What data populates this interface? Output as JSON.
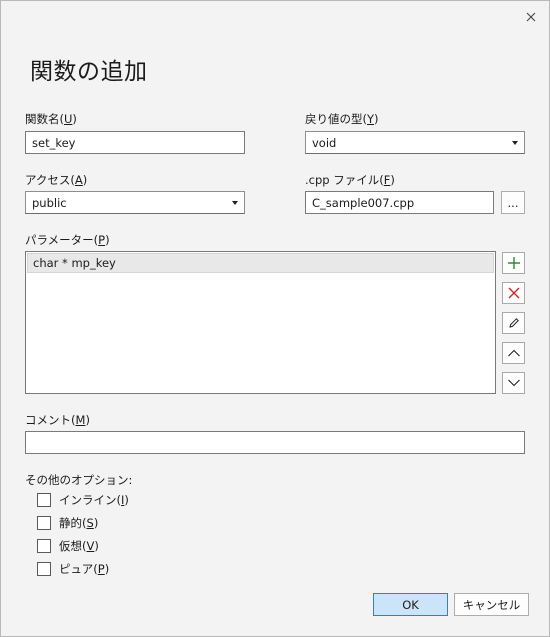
{
  "dialog": {
    "title": "関数の追加"
  },
  "function_name": {
    "label": "関数名(",
    "mnemonic": "U",
    "label_end": ")",
    "value": "set_key"
  },
  "return_type": {
    "label": "戻り値の型(",
    "mnemonic": "Y",
    "label_end": ")",
    "value": "void"
  },
  "access": {
    "label": "アクセス(",
    "mnemonic": "A",
    "label_end": ")",
    "value": "public"
  },
  "cpp_file": {
    "label": ".cpp ファイル(",
    "mnemonic": "F",
    "label_end": ")",
    "value": "C_sample007.cpp",
    "browse_label": "..."
  },
  "parameters": {
    "label": "パラメーター(",
    "mnemonic": "P",
    "label_end": ")",
    "items": [
      "char * mp_key"
    ]
  },
  "comment": {
    "label": "コメント(",
    "mnemonic": "M",
    "label_end": ")",
    "value": ""
  },
  "options": {
    "label": "その他のオプション:",
    "inline": {
      "label": "インライン(",
      "mnemonic": "I",
      "label_end": ")",
      "checked": false
    },
    "static": {
      "label": "静的(",
      "mnemonic": "S",
      "label_end": ")",
      "checked": false
    },
    "virtual": {
      "label": "仮想(",
      "mnemonic": "V",
      "label_end": ")",
      "checked": false
    },
    "pure": {
      "label": "ピュア(",
      "mnemonic": "P",
      "label_end": ")",
      "checked": false
    }
  },
  "buttons": {
    "ok": "OK",
    "cancel": "キャンセル"
  },
  "colors": {
    "add": "#2e8b2e",
    "remove": "#d2232a",
    "ok_bg": "#cce4f7",
    "ok_border": "#3c7fb1"
  }
}
